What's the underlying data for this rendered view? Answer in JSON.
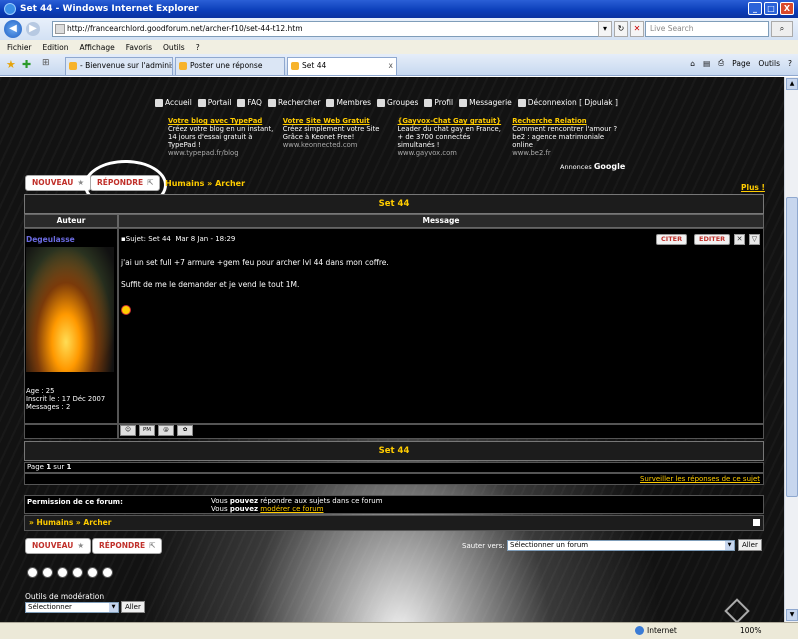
{
  "window": {
    "title": "Set 44 - Windows Internet Explorer",
    "min": "_",
    "max": "□",
    "close": "X"
  },
  "address": {
    "url": "http://francearchlord.goodforum.net/archer-f10/set-44-t12.htm",
    "search_placeholder": "Live Search"
  },
  "menu": [
    "Fichier",
    "Edition",
    "Affichage",
    "Favoris",
    "Outils",
    "?"
  ],
  "tabs": [
    {
      "label": "- Bienvenue sur l'administrati..."
    },
    {
      "label": "Poster une réponse"
    },
    {
      "label": "Set 44"
    }
  ],
  "tab_tools": {
    "page": "Page",
    "tools": "Outils"
  },
  "forum_nav": [
    "Accueil",
    "Portail",
    "FAQ",
    "Rechercher",
    "Membres",
    "Groupes",
    "Profil",
    "Messagerie",
    "Déconnexion [ Djoulak ]"
  ],
  "ads": [
    {
      "title": "Votre blog avec TypePad",
      "text": "Créez votre blog en un instant, 14 jours d'essai gratuit à TypePad !",
      "url": "www.typepad.fr/blog"
    },
    {
      "title": "Votre Site Web Gratuit",
      "text": "Créez simplement votre Site Grâce à Keonet Free!",
      "url": "www.keonnected.com"
    },
    {
      "title": "{Gayvox-Chat Gay gratuit}",
      "text": "Leader du chat gay en France, + de 3700 connectés simultanés !",
      "url": "www.gayvox.com"
    },
    {
      "title": "Recherche Relation",
      "text": "Comment rencontrer l'amour ? be2 : agence matrimoniale online",
      "url": "www.be2.fr"
    }
  ],
  "ads_label": "Annonces",
  "ads_brand": "Google",
  "buttons": {
    "new": "NOUVEAU",
    "reply": "RÉPONDRE",
    "new_icon": "★",
    "reply_icon": "⇱"
  },
  "breadcrumb": "Humains » Archer",
  "breadcrumb_bottom": "» Humains » Archer",
  "plus": "Plus !",
  "topic_title": "Set 44",
  "headers": {
    "author": "Auteur",
    "message": "Message"
  },
  "post": {
    "author": "Degeulasse",
    "subject_label": "Sujet:",
    "subject": "Set 44",
    "date": "Mar 8 Jan - 18:29",
    "quote": "CITER",
    "edit": "EDITER",
    "line1": "j'ai un set full +7 armure +gem feu pour archer lvl 44 dans mon coffre.",
    "line2": "Suffit de me le demander et je vend le tout 1M.",
    "age": "Age : 25",
    "joined": "Inscrit le : 17 Déc 2007",
    "messages": "Messages : 2"
  },
  "pagination": {
    "page": "Page",
    "current": "1",
    "of": "sur",
    "total": "1"
  },
  "watch": "Surveiller les réponses de ce sujet",
  "permissions": {
    "label": "Permission de ce forum:",
    "line1_a": "Vous",
    "line1_b": "pouvez",
    "line1_c": "répondre aux sujets dans ce forum",
    "line2_a": "Vous",
    "line2_b": "pouvez",
    "line2_link": "modérer ce forum"
  },
  "jump": {
    "label": "Sauter vers:",
    "value": "Sélectionner un forum",
    "go": "Aller"
  },
  "moderation": {
    "label": "Outils de modération",
    "value": "Sélectionner",
    "go": "Aller"
  },
  "status": {
    "zone": "Internet",
    "zoom": "100%"
  }
}
